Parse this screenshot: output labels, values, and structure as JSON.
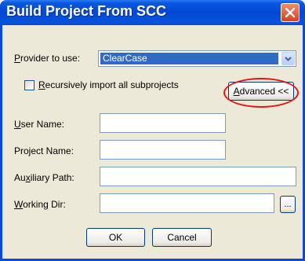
{
  "window": {
    "title": "Build Project From SCC"
  },
  "provider": {
    "label_prefix": "P",
    "label_rest": "rovider to use:",
    "value": "ClearCase"
  },
  "recursive": {
    "label_prefix": "R",
    "label_rest": "ecursively import all subprojects",
    "checked": false
  },
  "advanced_button": {
    "label_prefix": "A",
    "label_rest": "dvanced <<"
  },
  "fields": {
    "user_name": {
      "label_prefix": "U",
      "label_rest": "ser Name:",
      "value": ""
    },
    "project_name": {
      "label": "Project Name:",
      "value": ""
    },
    "auxiliary_path": {
      "label_pre": "Au",
      "label_u": "x",
      "label_post": "iliary Path:",
      "value": ""
    },
    "working_dir": {
      "label_prefix": "W",
      "label_rest": "orking Dir:",
      "value": ""
    }
  },
  "browse_button": {
    "label": "..."
  },
  "ok_button": {
    "label": "OK"
  },
  "cancel_button": {
    "label": "Cancel"
  },
  "colors": {
    "title_bar": "#0447d6",
    "highlight_ring": "#e01818",
    "selection": "#316ac5"
  }
}
